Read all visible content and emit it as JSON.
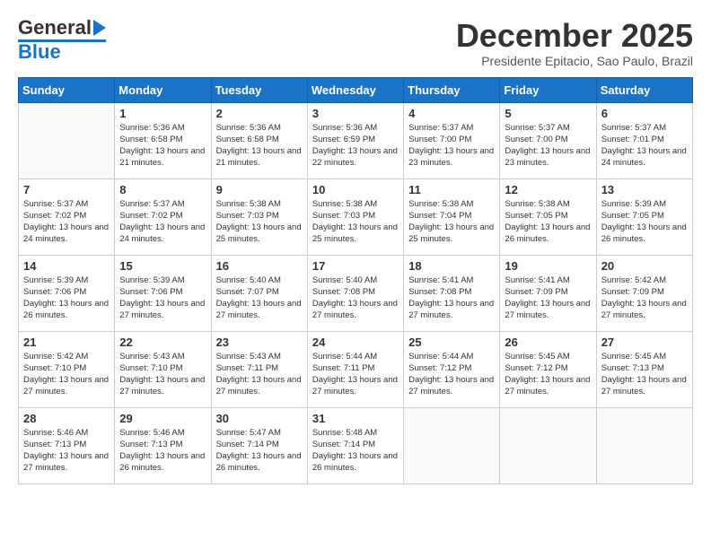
{
  "logo": {
    "general": "General",
    "blue": "Blue"
  },
  "title": {
    "month": "December 2025",
    "location": "Presidente Epitacio, Sao Paulo, Brazil"
  },
  "days": [
    "Sunday",
    "Monday",
    "Tuesday",
    "Wednesday",
    "Thursday",
    "Friday",
    "Saturday"
  ],
  "weeks": [
    [
      {
        "num": "",
        "sunrise": "",
        "sunset": "",
        "daylight": ""
      },
      {
        "num": "1",
        "sunrise": "Sunrise: 5:36 AM",
        "sunset": "Sunset: 6:58 PM",
        "daylight": "Daylight: 13 hours and 21 minutes."
      },
      {
        "num": "2",
        "sunrise": "Sunrise: 5:36 AM",
        "sunset": "Sunset: 6:58 PM",
        "daylight": "Daylight: 13 hours and 21 minutes."
      },
      {
        "num": "3",
        "sunrise": "Sunrise: 5:36 AM",
        "sunset": "Sunset: 6:59 PM",
        "daylight": "Daylight: 13 hours and 22 minutes."
      },
      {
        "num": "4",
        "sunrise": "Sunrise: 5:37 AM",
        "sunset": "Sunset: 7:00 PM",
        "daylight": "Daylight: 13 hours and 23 minutes."
      },
      {
        "num": "5",
        "sunrise": "Sunrise: 5:37 AM",
        "sunset": "Sunset: 7:00 PM",
        "daylight": "Daylight: 13 hours and 23 minutes."
      },
      {
        "num": "6",
        "sunrise": "Sunrise: 5:37 AM",
        "sunset": "Sunset: 7:01 PM",
        "daylight": "Daylight: 13 hours and 24 minutes."
      }
    ],
    [
      {
        "num": "7",
        "sunrise": "Sunrise: 5:37 AM",
        "sunset": "Sunset: 7:02 PM",
        "daylight": "Daylight: 13 hours and 24 minutes."
      },
      {
        "num": "8",
        "sunrise": "Sunrise: 5:37 AM",
        "sunset": "Sunset: 7:02 PM",
        "daylight": "Daylight: 13 hours and 24 minutes."
      },
      {
        "num": "9",
        "sunrise": "Sunrise: 5:38 AM",
        "sunset": "Sunset: 7:03 PM",
        "daylight": "Daylight: 13 hours and 25 minutes."
      },
      {
        "num": "10",
        "sunrise": "Sunrise: 5:38 AM",
        "sunset": "Sunset: 7:03 PM",
        "daylight": "Daylight: 13 hours and 25 minutes."
      },
      {
        "num": "11",
        "sunrise": "Sunrise: 5:38 AM",
        "sunset": "Sunset: 7:04 PM",
        "daylight": "Daylight: 13 hours and 25 minutes."
      },
      {
        "num": "12",
        "sunrise": "Sunrise: 5:38 AM",
        "sunset": "Sunset: 7:05 PM",
        "daylight": "Daylight: 13 hours and 26 minutes."
      },
      {
        "num": "13",
        "sunrise": "Sunrise: 5:39 AM",
        "sunset": "Sunset: 7:05 PM",
        "daylight": "Daylight: 13 hours and 26 minutes."
      }
    ],
    [
      {
        "num": "14",
        "sunrise": "Sunrise: 5:39 AM",
        "sunset": "Sunset: 7:06 PM",
        "daylight": "Daylight: 13 hours and 26 minutes."
      },
      {
        "num": "15",
        "sunrise": "Sunrise: 5:39 AM",
        "sunset": "Sunset: 7:06 PM",
        "daylight": "Daylight: 13 hours and 27 minutes."
      },
      {
        "num": "16",
        "sunrise": "Sunrise: 5:40 AM",
        "sunset": "Sunset: 7:07 PM",
        "daylight": "Daylight: 13 hours and 27 minutes."
      },
      {
        "num": "17",
        "sunrise": "Sunrise: 5:40 AM",
        "sunset": "Sunset: 7:08 PM",
        "daylight": "Daylight: 13 hours and 27 minutes."
      },
      {
        "num": "18",
        "sunrise": "Sunrise: 5:41 AM",
        "sunset": "Sunset: 7:08 PM",
        "daylight": "Daylight: 13 hours and 27 minutes."
      },
      {
        "num": "19",
        "sunrise": "Sunrise: 5:41 AM",
        "sunset": "Sunset: 7:09 PM",
        "daylight": "Daylight: 13 hours and 27 minutes."
      },
      {
        "num": "20",
        "sunrise": "Sunrise: 5:42 AM",
        "sunset": "Sunset: 7:09 PM",
        "daylight": "Daylight: 13 hours and 27 minutes."
      }
    ],
    [
      {
        "num": "21",
        "sunrise": "Sunrise: 5:42 AM",
        "sunset": "Sunset: 7:10 PM",
        "daylight": "Daylight: 13 hours and 27 minutes."
      },
      {
        "num": "22",
        "sunrise": "Sunrise: 5:43 AM",
        "sunset": "Sunset: 7:10 PM",
        "daylight": "Daylight: 13 hours and 27 minutes."
      },
      {
        "num": "23",
        "sunrise": "Sunrise: 5:43 AM",
        "sunset": "Sunset: 7:11 PM",
        "daylight": "Daylight: 13 hours and 27 minutes."
      },
      {
        "num": "24",
        "sunrise": "Sunrise: 5:44 AM",
        "sunset": "Sunset: 7:11 PM",
        "daylight": "Daylight: 13 hours and 27 minutes."
      },
      {
        "num": "25",
        "sunrise": "Sunrise: 5:44 AM",
        "sunset": "Sunset: 7:12 PM",
        "daylight": "Daylight: 13 hours and 27 minutes."
      },
      {
        "num": "26",
        "sunrise": "Sunrise: 5:45 AM",
        "sunset": "Sunset: 7:12 PM",
        "daylight": "Daylight: 13 hours and 27 minutes."
      },
      {
        "num": "27",
        "sunrise": "Sunrise: 5:45 AM",
        "sunset": "Sunset: 7:13 PM",
        "daylight": "Daylight: 13 hours and 27 minutes."
      }
    ],
    [
      {
        "num": "28",
        "sunrise": "Sunrise: 5:46 AM",
        "sunset": "Sunset: 7:13 PM",
        "daylight": "Daylight: 13 hours and 27 minutes."
      },
      {
        "num": "29",
        "sunrise": "Sunrise: 5:46 AM",
        "sunset": "Sunset: 7:13 PM",
        "daylight": "Daylight: 13 hours and 26 minutes."
      },
      {
        "num": "30",
        "sunrise": "Sunrise: 5:47 AM",
        "sunset": "Sunset: 7:14 PM",
        "daylight": "Daylight: 13 hours and 26 minutes."
      },
      {
        "num": "31",
        "sunrise": "Sunrise: 5:48 AM",
        "sunset": "Sunset: 7:14 PM",
        "daylight": "Daylight: 13 hours and 26 minutes."
      },
      {
        "num": "",
        "sunrise": "",
        "sunset": "",
        "daylight": ""
      },
      {
        "num": "",
        "sunrise": "",
        "sunset": "",
        "daylight": ""
      },
      {
        "num": "",
        "sunrise": "",
        "sunset": "",
        "daylight": ""
      }
    ]
  ]
}
